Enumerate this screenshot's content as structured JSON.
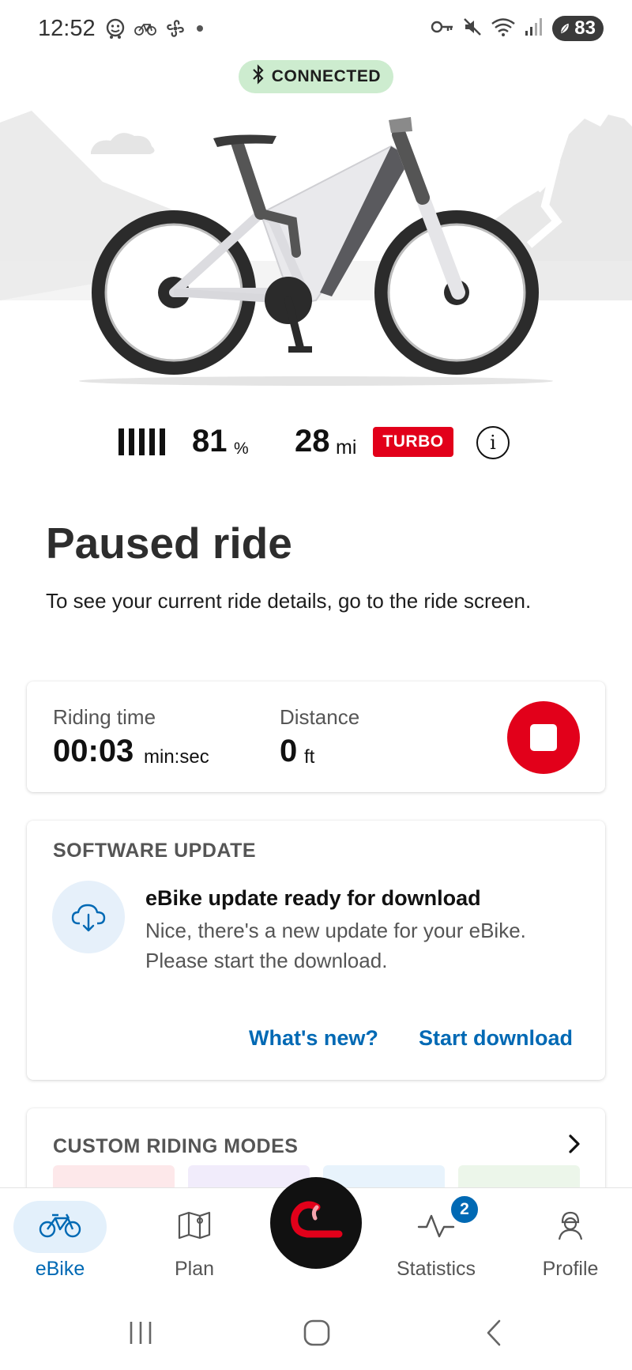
{
  "status_bar": {
    "time": "12:52",
    "battery_percent": "83",
    "icons_left": [
      "waze-icon",
      "bike-icon",
      "fan-icon",
      "dot-icon"
    ],
    "icons_right": [
      "key-icon",
      "mute-icon",
      "wifi-icon",
      "signal-icon",
      "battery-icon"
    ]
  },
  "connection": {
    "label": "CONNECTED",
    "icon": "bluetooth-icon"
  },
  "bike_stats": {
    "battery_value": "81",
    "battery_unit": "%",
    "range_value": "28",
    "range_unit": "mi",
    "mode": "TURBO",
    "mode_color": "#e2001a",
    "info_glyph": "i"
  },
  "paused_ride": {
    "title": "Paused ride",
    "description": "To see your current ride details, go to the ride screen."
  },
  "ride_card": {
    "riding_time_label": "Riding time",
    "riding_time_value": "00:03",
    "riding_time_unit": "min:sec",
    "distance_label": "Distance",
    "distance_value": "0",
    "distance_unit": "ft"
  },
  "software_update": {
    "section_title": "SOFTWARE UPDATE",
    "title": "eBike update ready for download",
    "description": "Nice, there's a new update for your eBike. Please start the download.",
    "whats_new_label": "What's new?",
    "start_download_label": "Start download"
  },
  "custom_modes": {
    "section_title": "CUSTOM RIDING MODES",
    "swatch_colors": [
      "#fde8ea",
      "#f1ecfb",
      "#e8f3fc",
      "#ecf6ea"
    ]
  },
  "bottom_nav": {
    "items": [
      {
        "label": "eBike",
        "icon": "bike-icon",
        "active": true
      },
      {
        "label": "Plan",
        "icon": "map-icon",
        "active": false
      },
      {
        "label": "",
        "icon": "brand-logo-icon",
        "active": false
      },
      {
        "label": "Statistics",
        "icon": "activity-icon",
        "active": false
      },
      {
        "label": "Profile",
        "icon": "person-icon",
        "active": false
      }
    ],
    "statistics_badge": "2"
  },
  "colors": {
    "accent": "#0069b4",
    "danger": "#e2001a",
    "connected_bg": "#cdeccf"
  }
}
